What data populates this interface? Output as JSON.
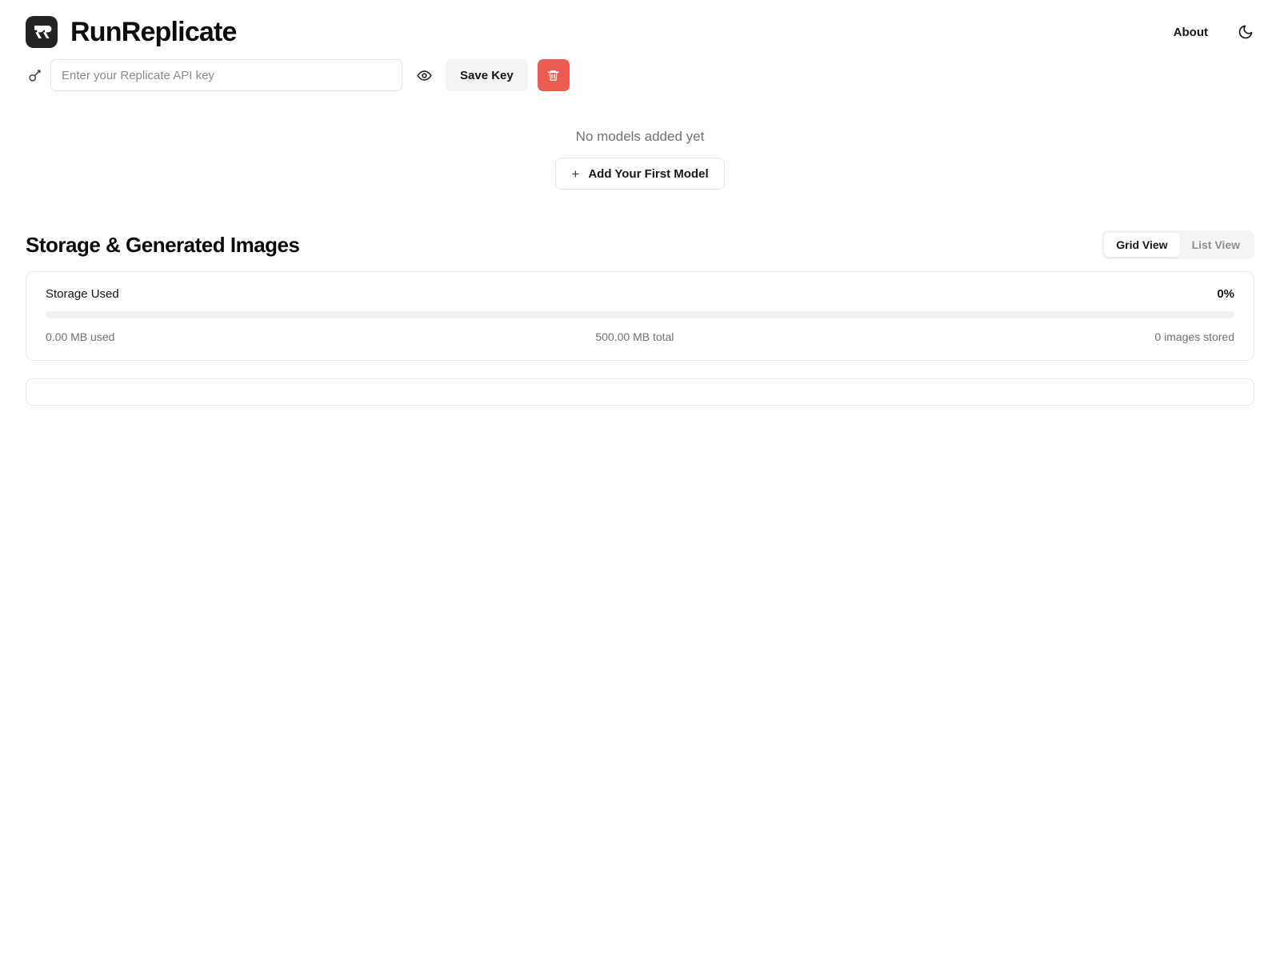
{
  "header": {
    "brand_name": "RunReplicate",
    "logo_icon": "rr-monogram-icon",
    "about_label": "About",
    "theme_toggle_icon": "moon-icon"
  },
  "api_key": {
    "key_icon": "key-icon",
    "input_value": "",
    "placeholder": "Enter your Replicate API key",
    "reveal_icon": "eye-icon",
    "save_label": "Save Key",
    "delete_icon": "trash-icon",
    "delete_color": "#ec5a52"
  },
  "models": {
    "empty_text": "No models added yet",
    "add_button_label": "Add Your First Model",
    "add_button_icon": "plus-icon"
  },
  "storage": {
    "section_title": "Storage & Generated Images",
    "view_toggle": {
      "options": [
        "Grid View",
        "List View"
      ],
      "grid_label": "Grid View",
      "list_label": "List View",
      "active": "Grid View"
    },
    "used_label": "Storage Used",
    "percent_label": "0%",
    "percent_value": 0,
    "used_text": "0.00 MB used",
    "total_text": "500.00 MB total",
    "images_text": "0 images stored"
  }
}
